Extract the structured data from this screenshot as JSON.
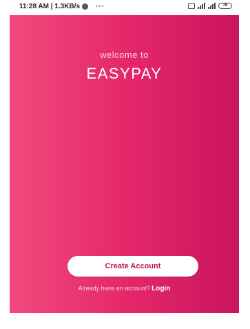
{
  "status_bar": {
    "left_text": "11:28 AM | 1.3KB/s",
    "dots": "···",
    "battery": "76"
  },
  "screen": {
    "welcome_text": "welcome to",
    "brand_name": "EASYPAY",
    "create_account_label": "Create Account",
    "login_prompt": "Already have an account? ",
    "login_label": "Login"
  },
  "colors": {
    "gradient_left": "#f04a7d",
    "gradient_mid": "#e5286a",
    "gradient_right": "#c9145e",
    "button_text": "#c0145a"
  }
}
